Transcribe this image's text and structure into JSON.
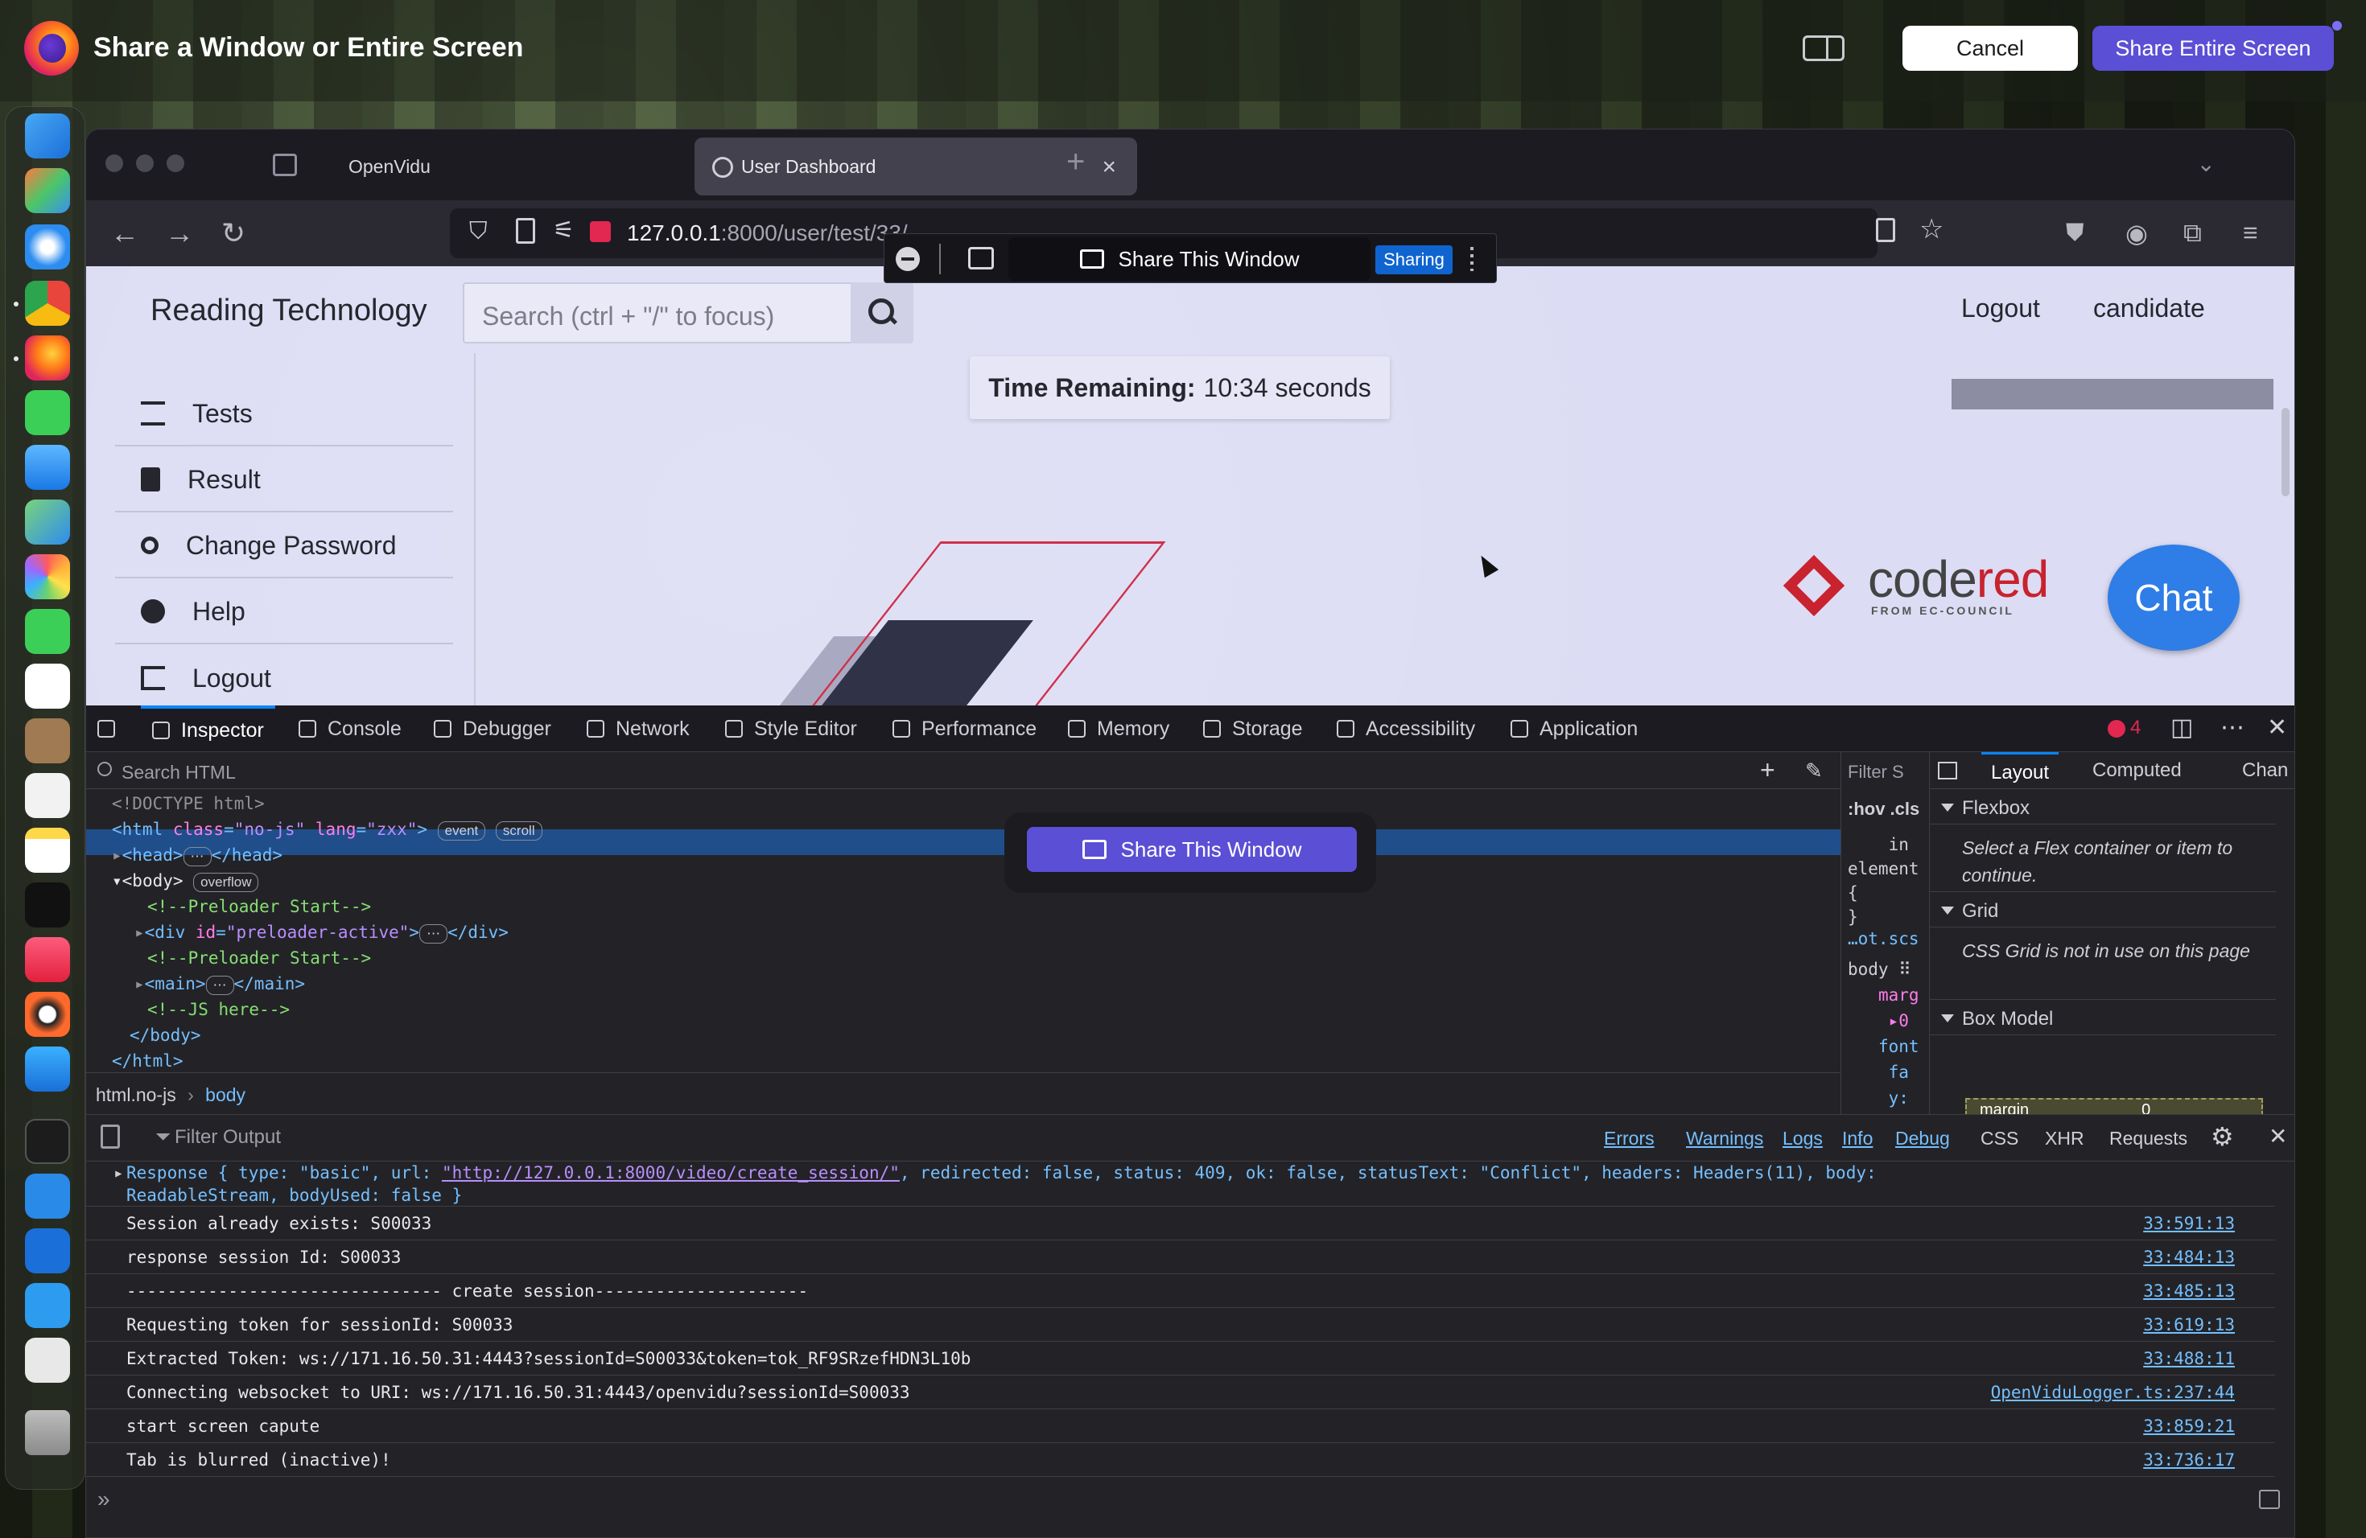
{
  "share_dialog": {
    "title": "Share a Window or Entire Screen",
    "cancel_label": "Cancel",
    "share_label": "Share Entire Screen"
  },
  "browser": {
    "tabs": [
      {
        "label": "OpenVidu"
      },
      {
        "label": "User Dashboard"
      }
    ],
    "url_host": "127.0.0.1",
    "url_rest": ":8000/user/test/33/"
  },
  "sharing_pill": {
    "label": "Share This Window",
    "badge": "Sharing"
  },
  "page": {
    "brand": "Reading Technology",
    "search_placeholder": "Search (ctrl + \"/\" to focus)",
    "logout": "Logout",
    "user": "candidate",
    "timer_label": "Time Remaining:",
    "timer_value": "10:34 seconds",
    "menu": [
      "Tests",
      "Result",
      "Change Password",
      "Help",
      "Logout"
    ],
    "codered_word1": "code",
    "codered_word2": "red",
    "codered_sub": "FROM EC-COUNCIL",
    "chat": "Chat"
  },
  "devtools": {
    "tabs": [
      "Inspector",
      "Console",
      "Debugger",
      "Network",
      "Style Editor",
      "Performance",
      "Memory",
      "Storage",
      "Accessibility",
      "Application"
    ],
    "error_count": "4",
    "search_html": "Search HTML",
    "breadcrumb": [
      "html.no-js",
      "body"
    ],
    "rules_filter": "Filter S",
    "rules_hov": ":hov .cls",
    "layout_tabs": [
      "Layout",
      "Computed",
      "Chan"
    ],
    "flexbox_head": "Flexbox",
    "flexbox_body": "Select a Flex container or item to continue.",
    "grid_head": "Grid",
    "grid_body": "CSS Grid is not in use on this page",
    "boxmodel_head": "Box Model",
    "boxmodel_margin": "margin",
    "boxmodel_val": "0",
    "share_button": "Share This Window"
  },
  "console": {
    "filter": "Filter Output",
    "levels": [
      "Errors",
      "Warnings",
      "Logs",
      "Info",
      "Debug"
    ],
    "extra": [
      "CSS",
      "XHR",
      "Requests"
    ],
    "messages": [
      {
        "text": "Session already exists: S00033",
        "src": "33:591:13"
      },
      {
        "text": "response session Id: S00033",
        "src": "33:484:13"
      },
      {
        "text": "------------------------------- create session---------------------",
        "src": "33:485:13"
      },
      {
        "text": "Requesting token for sessionId: S00033",
        "src": "33:619:13"
      },
      {
        "text": "Extracted Token: ws://171.16.50.31:4443?sessionId=S00033&token=tok_RF9SRzefHDN3L10b",
        "src": "33:488:11"
      },
      {
        "text": "Connecting websocket to URI: ws://171.16.50.31:4443/openvidu?sessionId=S00033",
        "src": "OpenViduLogger.ts:237:44"
      },
      {
        "text": "start screen capute",
        "src": "33:859:21"
      },
      {
        "text": "Tab is blurred (inactive)!",
        "src": "33:736:17"
      }
    ],
    "response_line1_a": "Response { type: \"basic\", url: ",
    "response_url": "\"http://127.0.0.1:8000/video/create_session/\"",
    "response_line1_b": ", redirected: false, status: 409, ok: false, statusText: \"Conflict\", headers: Headers(11), body:",
    "response_line2": "ReadableStream, bodyUsed: false }"
  }
}
